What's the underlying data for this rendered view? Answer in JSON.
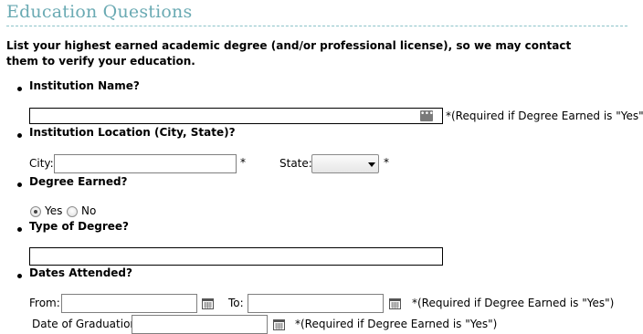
{
  "section": {
    "title": "Education Questions",
    "intro": "List your highest earned academic degree (and/or professional license), so we may contact them to verify your education."
  },
  "institution_name": {
    "question": "Institution Name?",
    "value": "",
    "note": "*(Required if Degree Earned is \"Yes\")"
  },
  "institution_location": {
    "question": "Institution Location (City, State)?",
    "city_label": "City:",
    "city_value": "",
    "city_required": "*",
    "state_label": "State:",
    "state_value": "",
    "state_required": "*"
  },
  "degree_earned": {
    "question": "Degree Earned?",
    "options": [
      "Yes",
      "No"
    ],
    "selected": "Yes"
  },
  "degree_type": {
    "question": "Type of Degree?",
    "value": ""
  },
  "dates_attended": {
    "question": "Dates Attended?",
    "from_label": "From:",
    "from_value": "",
    "to_label": "To:",
    "to_value": "",
    "note": "*(Required if Degree Earned is \"Yes\")",
    "graduation_label": "Date of Graduation:",
    "graduation_value": "",
    "graduation_note": "*(Required if Degree Earned is \"Yes\")"
  },
  "icons": {
    "lookup": "ellipsis-icon",
    "calendar": "calendar-icon",
    "dropdown": "chevron-down-icon"
  }
}
